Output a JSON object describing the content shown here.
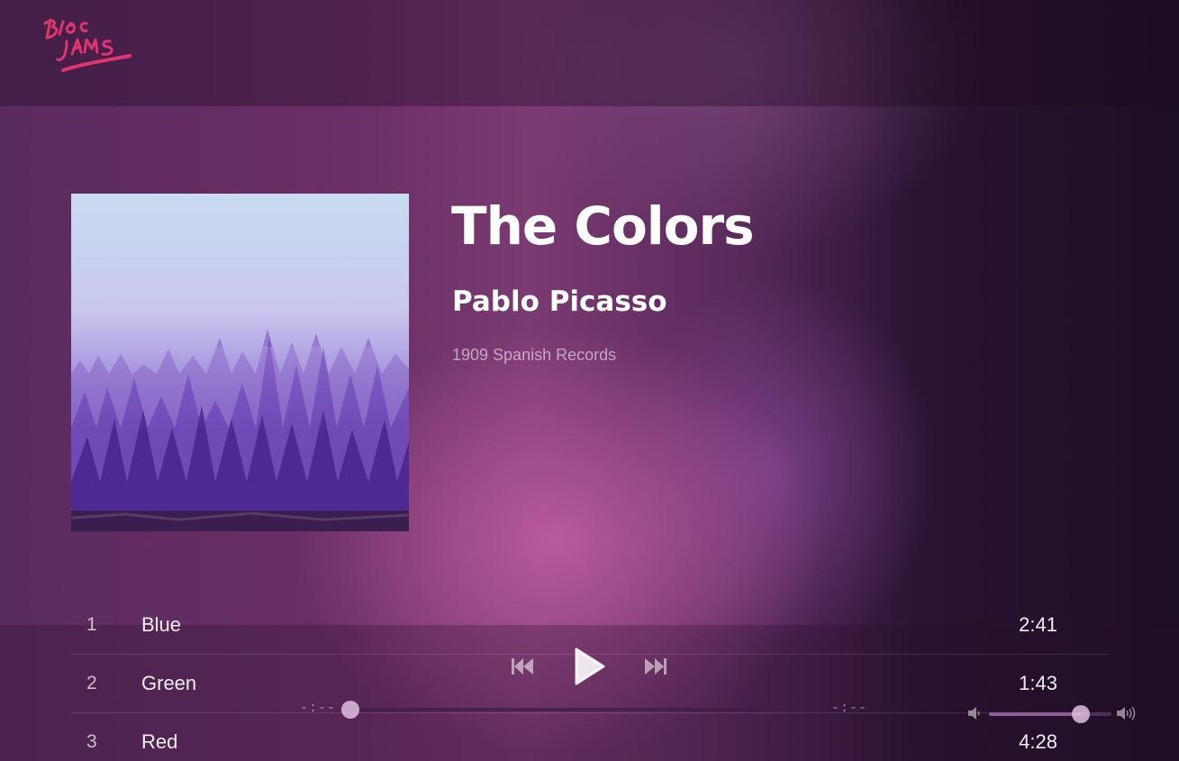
{
  "app": {
    "logo_text": "Bloc Jams",
    "colors": {
      "logo": "#e0346e",
      "accent": "#b85a9a"
    }
  },
  "album": {
    "title": "The Colors",
    "artist": "Pablo Picasso",
    "release": "1909 Spanish Records",
    "cover_icon": "foggy-forest-cover"
  },
  "songs": [
    {
      "number": "1",
      "title": "Blue",
      "duration": "2:41"
    },
    {
      "number": "2",
      "title": "Green",
      "duration": "1:43"
    },
    {
      "number": "3",
      "title": "Red",
      "duration": "4:28"
    }
  ],
  "player": {
    "current_time": "-:--",
    "total_time": "-:--",
    "seek_fraction": 0.0,
    "volume_fraction": 0.75,
    "controls": [
      "previous-icon",
      "play-icon",
      "next-icon"
    ],
    "volume_icons": [
      "volume-down-icon",
      "volume-up-icon"
    ]
  }
}
